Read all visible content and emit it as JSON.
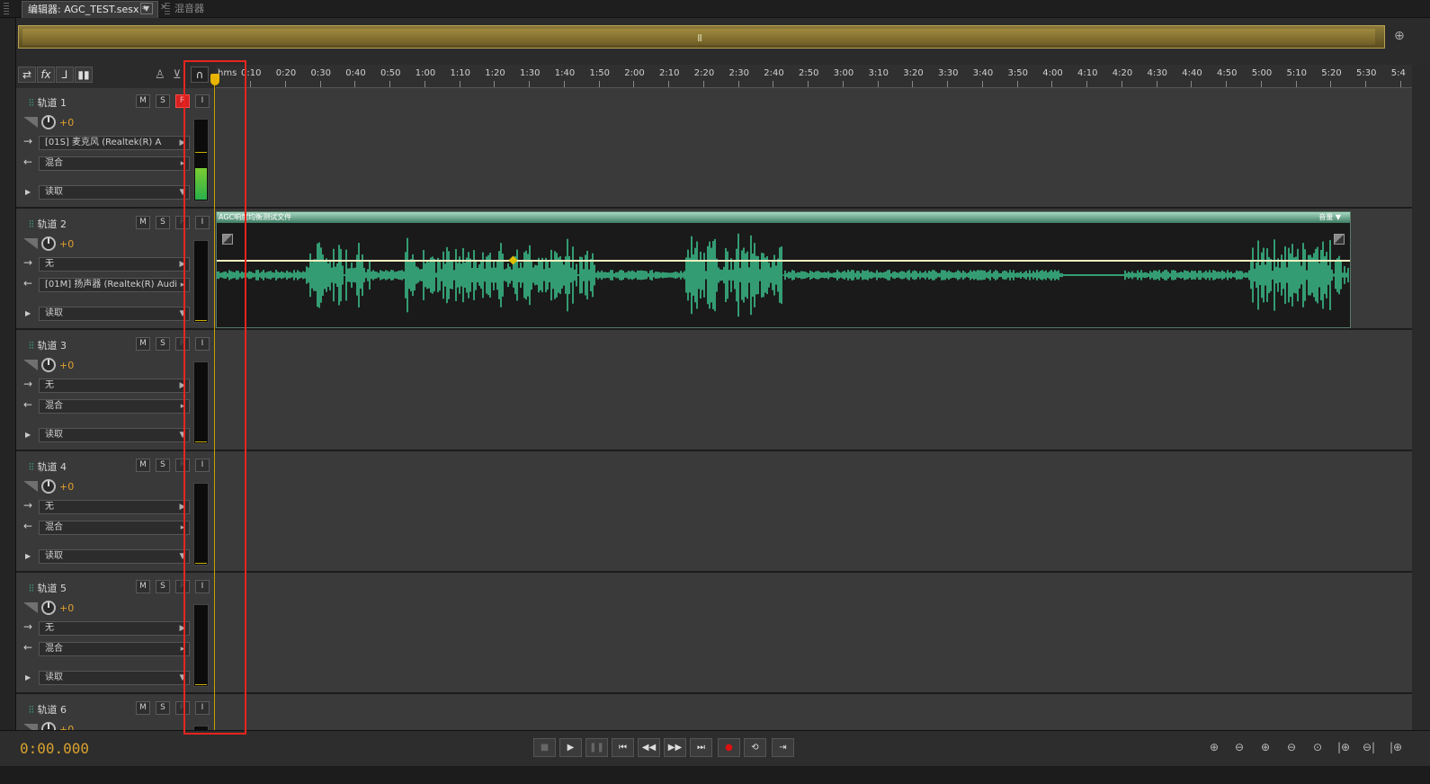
{
  "tabs": [
    {
      "label": "编辑器: AGC_TEST.sesx *",
      "active": true
    },
    {
      "label": "混音器",
      "active": false
    }
  ],
  "toolbar": {
    "icons": [
      "swap-icon",
      "fx-icon",
      "send-icon",
      "eq-icon",
      "metronome-icon",
      "input-monitor-icon",
      "headphones-icon"
    ],
    "fx_label": "fx"
  },
  "ruler": {
    "unit": "hms",
    "ticks": [
      "0:10",
      "0:20",
      "0:30",
      "0:40",
      "0:50",
      "1:00",
      "1:10",
      "1:20",
      "1:30",
      "1:40",
      "1:50",
      "2:00",
      "2:10",
      "2:20",
      "2:30",
      "2:40",
      "2:50",
      "3:00",
      "3:10",
      "3:20",
      "3:30",
      "3:40",
      "3:50",
      "4:00",
      "4:10",
      "4:20",
      "4:30",
      "4:40",
      "4:50",
      "5:00",
      "5:10",
      "5:20",
      "5:30",
      "5:4"
    ]
  },
  "buttons": {
    "m": "M",
    "s": "S",
    "r": "R",
    "i": "I"
  },
  "tracks": [
    {
      "name": "轨道 1",
      "volume": "+0",
      "input": "[01S] 麦克风 (Realtek(R) A",
      "output": "混合",
      "automation": "读取",
      "record_armed": true,
      "meter_level": 0.4
    },
    {
      "name": "轨道 2",
      "volume": "+0",
      "input": "无",
      "output": "[01M] 扬声器 (Realtek(R) Audi",
      "automation": "读取",
      "record_armed": false,
      "meter_level": 0
    },
    {
      "name": "轨道 3",
      "volume": "+0",
      "input": "无",
      "output": "混合",
      "automation": "读取",
      "record_armed": false,
      "meter_level": 0
    },
    {
      "name": "轨道 4",
      "volume": "+0",
      "input": "无",
      "output": "混合",
      "automation": "读取",
      "record_armed": false,
      "meter_level": 0
    },
    {
      "name": "轨道 5",
      "volume": "+0",
      "input": "无",
      "output": "混合",
      "automation": "读取",
      "record_armed": false,
      "meter_level": 0
    },
    {
      "name": "轨道 6",
      "volume": "+0",
      "input": "",
      "output": "",
      "automation": "",
      "record_armed": false,
      "meter_level": 0
    }
  ],
  "clip": {
    "title": "AGC响度均衡测试文件",
    "volume_label": "音量",
    "track_index": 1
  },
  "transport": {
    "timecode": "0:00.000",
    "buttons": [
      "stop-icon",
      "play-icon",
      "pause-icon",
      "go-to-start-icon",
      "rewind-icon",
      "fast-forward-icon",
      "go-to-end-icon",
      "record-icon",
      "loop-icon",
      "skip-selection-icon"
    ]
  },
  "colors": {
    "accent_orange": "#d8a230",
    "waveform": "#3fd59a",
    "record": "#d82020",
    "highlight_box": "#e8241e"
  }
}
